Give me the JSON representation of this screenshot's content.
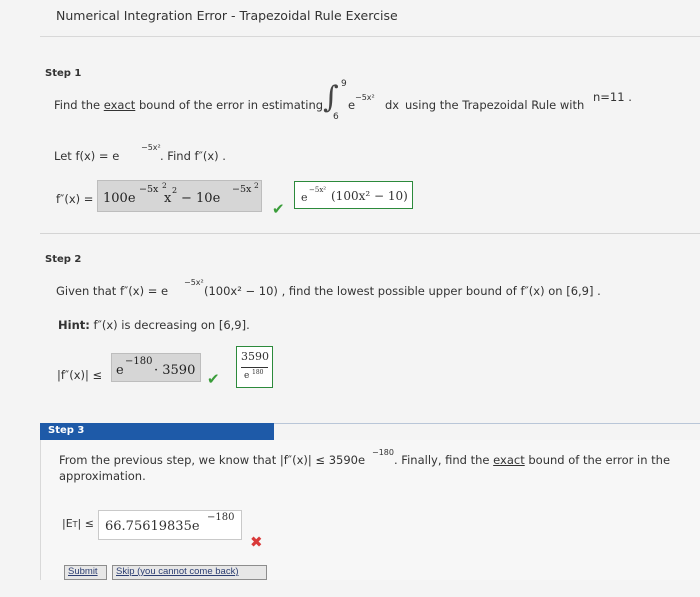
{
  "page": {
    "title": "Numerical Integration Error - Trapezoidal Rule Exercise"
  },
  "step1": {
    "label": "Step 1",
    "prompt_before": "Find the",
    "prompt_exact": "exact",
    "prompt_after": "bound of the error in estimating",
    "integral_upper": "9",
    "integral_lower": "6",
    "integrand": "e",
    "integrand_exp": "−5x²",
    "integrand_dx": "dx",
    "using_text": "using the Trapezoidal Rule with",
    "n_text": "n=11 .",
    "let_prefix": "Let",
    "let_fx": "f(x) = e",
    "let_exp": "−5x²",
    "let_suffix": ". Find  f″(x) .",
    "answer_label": "f″(x) =",
    "user_answer_a": "100e",
    "user_answer_a_exp": "−5x",
    "user_answer_a_exp2": "2",
    "user_answer_b": "x",
    "user_answer_b_exp": "2",
    "user_answer_c": "− 10e",
    "user_answer_c_exp": "−5x",
    "user_answer_c_exp2": "2",
    "correct_answer_e": "e",
    "correct_answer_exp": "−5x²",
    "correct_answer_rest": "(100x² − 10)"
  },
  "step2": {
    "label": "Step 2",
    "given_before": "Given that  f″(x) = e",
    "given_exp": "−5x²",
    "given_after": "(100x² − 10) ,  find the lowest possible upper bound of  f″(x) on [6,9] .",
    "hint_label": "Hint:",
    "hint_text": "f″(x) is decreasing on [6,9].",
    "answer_label": "|f″(x)| ≤",
    "user_answer_e": "e",
    "user_answer_exp": "−180",
    "user_answer_rest": "· 3590",
    "correct_num": "3590",
    "correct_den_e": "e",
    "correct_den_exp": "180"
  },
  "step3": {
    "label": "Step 3",
    "line1_before": "From the previous step, we know that  |f″(x)| ≤ 3590e",
    "line1_exp": "−180",
    "line1_after": ".  Finally, find the",
    "line1_exact": "exact",
    "line1_end": "bound of the error in the",
    "line2": "approximation.",
    "answer_label": "|E",
    "answer_label_sub": "T",
    "answer_label_end": "| ≤",
    "user_answer": "66.75619835e",
    "user_answer_exp": "−180"
  },
  "buttons": {
    "submit": "Submit",
    "skip": "Skip (you cannot come back)"
  },
  "colors": {
    "step3_bar": "#1e5aa8",
    "correct": "#3a9d3a",
    "incorrect": "#d93a3a"
  }
}
